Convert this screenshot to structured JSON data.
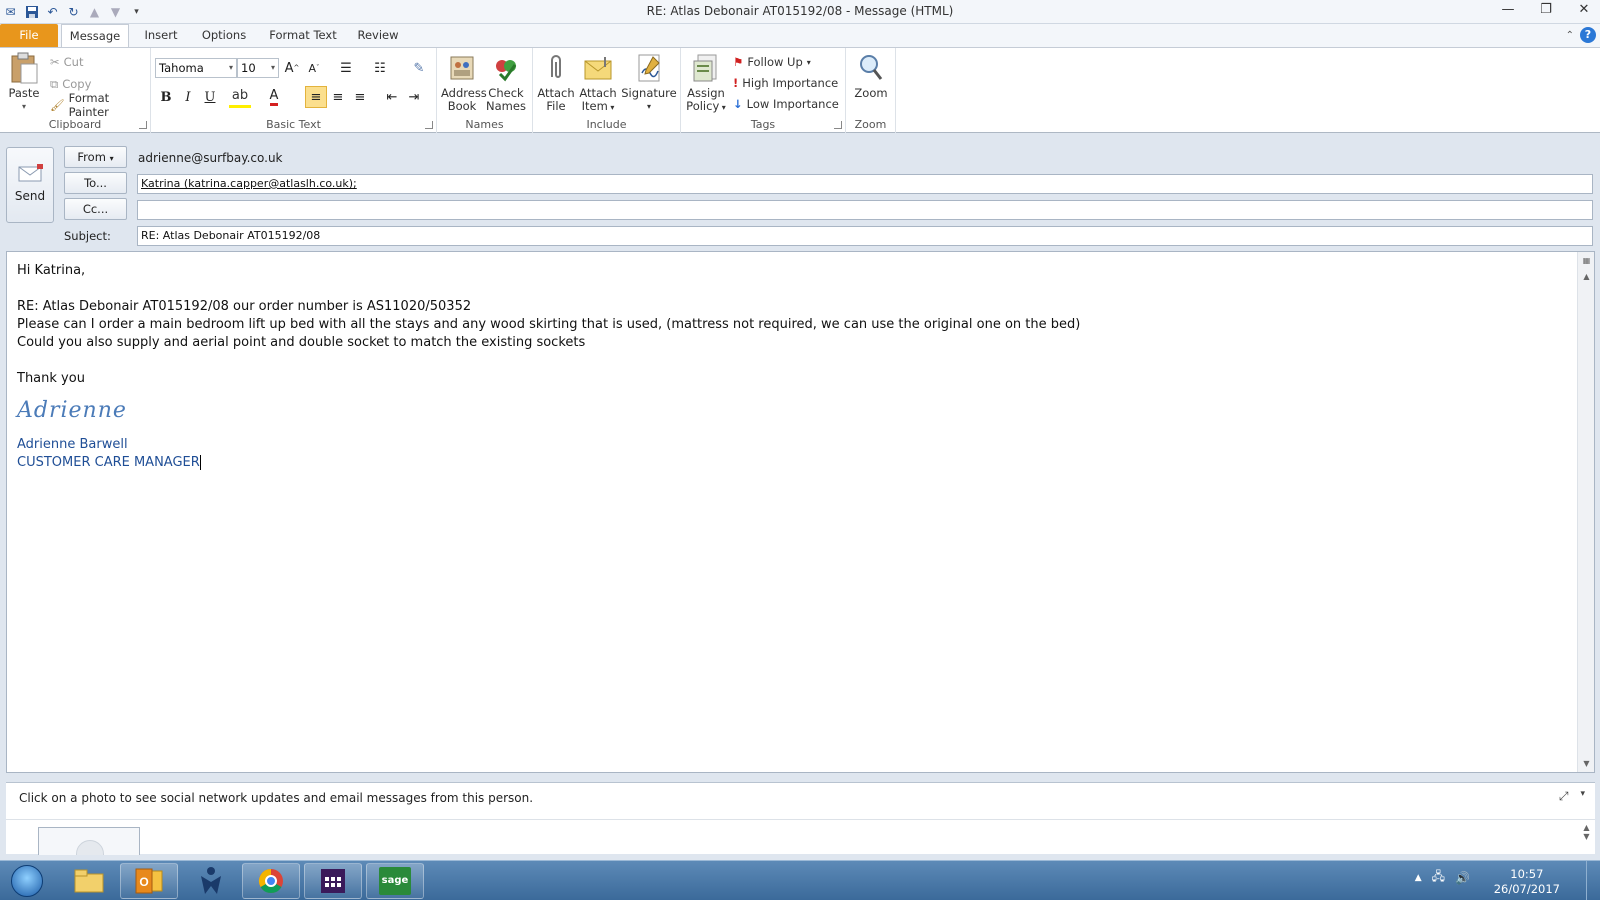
{
  "window": {
    "title": "RE: Atlas Debonair AT015192/08  -  Message (HTML)"
  },
  "ribbon": {
    "tabs": [
      "File",
      "Message",
      "Insert",
      "Options",
      "Format Text",
      "Review"
    ],
    "clipboard": {
      "label": "Clipboard",
      "paste": "Paste",
      "cut": "Cut",
      "copy": "Copy",
      "format_painter": "Format Painter"
    },
    "basic_text": {
      "label": "Basic Text",
      "font": "Tahoma",
      "size": "10",
      "bold": "B",
      "italic": "I",
      "underline": "U",
      "font_color_glyph": "A"
    },
    "names": {
      "label": "Names",
      "address_book_l1": "Address",
      "address_book_l2": "Book",
      "check_names_l1": "Check",
      "check_names_l2": "Names"
    },
    "include": {
      "label": "Include",
      "attach_file_l1": "Attach",
      "attach_file_l2": "File",
      "attach_item_l1": "Attach",
      "attach_item_l2": "Item",
      "signature": "Signature"
    },
    "tags": {
      "label": "Tags",
      "assign_policy_l1": "Assign",
      "assign_policy_l2": "Policy",
      "follow_up": "Follow Up",
      "high_importance": "High Importance",
      "low_importance": "Low Importance"
    },
    "zoom": {
      "label": "Zoom",
      "zoom": "Zoom"
    }
  },
  "header": {
    "send": "Send",
    "from_label": "From",
    "from_value": "adrienne@surfbay.co.uk",
    "to_label": "To...",
    "to_value": "Katrina (katrina.capper@atlaslh.co.uk);",
    "cc_label": "Cc...",
    "cc_value": "",
    "subject_label": "Subject:",
    "subject_value": "RE: Atlas Debonair AT015192/08"
  },
  "message": {
    "greeting": "Hi Katrina,",
    "line1": "RE: Atlas Debonair AT015192/08 our order number is AS11020/50352",
    "line2": "Please can I order a main bedroom lift up bed with all the stays and any wood skirting that is used, (mattress not required, we can use the original one on the bed)",
    "line3": "Could you also supply and aerial point and double socket to match the existing sockets",
    "thanks": "Thank you",
    "signature_script": "Adrienne",
    "sig_name": "Adrienne Barwell",
    "sig_title": "CUSTOMER CARE MANAGER"
  },
  "people_pane": {
    "hint": "Click on a photo to see social network updates and email messages from this person."
  },
  "taskbar": {
    "time": "10:57",
    "date": "26/07/2017",
    "sage_label": "sage"
  },
  "colors": {
    "file_tab": "#e8961c",
    "signature_blue": "#1f4e96",
    "highlight": "#fbdf8e",
    "taskbar": "#3b6a9a"
  }
}
